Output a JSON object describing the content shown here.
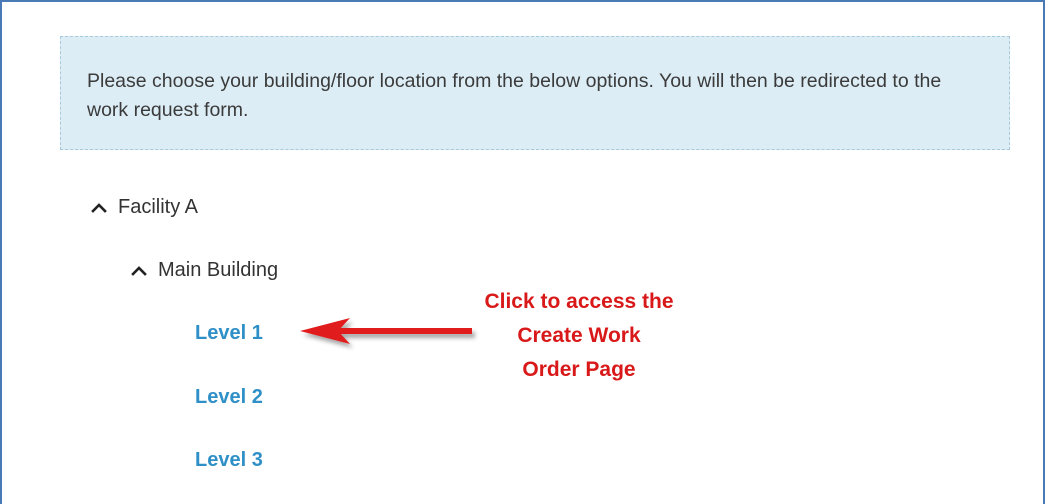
{
  "info": {
    "message": "Please choose your building/floor location from the below options. You will then be redirected to the work request form."
  },
  "tree": {
    "facility": {
      "label": "Facility A",
      "icon": "chevron-up-icon"
    },
    "building": {
      "label": "Main Building",
      "icon": "chevron-up-icon"
    },
    "levels": [
      {
        "label": "Level 1"
      },
      {
        "label": "Level 2"
      },
      {
        "label": "Level 3"
      }
    ]
  },
  "annotation": {
    "text": "Click to access the\nCreate Work\nOrder Page",
    "color": "#d91919"
  },
  "colors": {
    "link": "#2f8fc7",
    "info_bg": "#dcedf5",
    "frame": "#4a7ab5"
  }
}
